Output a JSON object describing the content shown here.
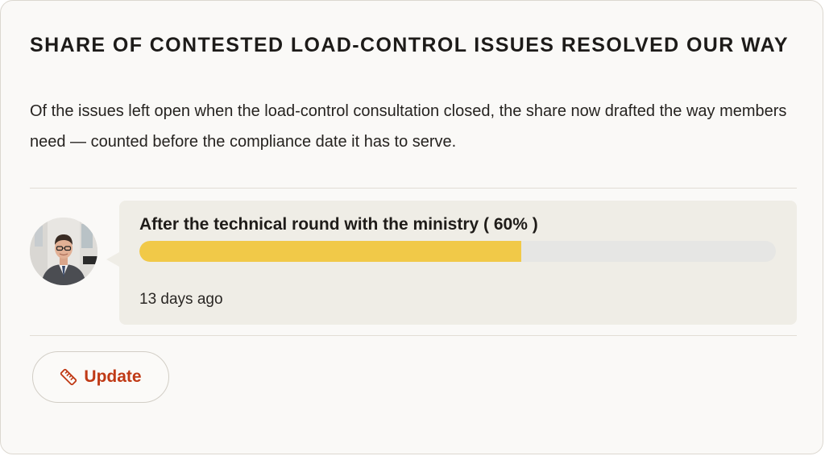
{
  "card": {
    "title": "SHARE OF CONTESTED LOAD-CONTROL ISSUES RESOLVED OUR WAY",
    "description": "Of the issues left open when the load-control consultation closed, the share now drafted the way members need — counted before the compliance date it has to serve."
  },
  "update_entry": {
    "label": "After the technical round with the ministry ( 60% )",
    "progress_percent": 60,
    "timestamp": "13 days ago",
    "avatar_icon": "person-photo",
    "bar_color": "#f1c948",
    "track_color": "#e6e6e4"
  },
  "actions": {
    "update_label": "Update",
    "update_icon": "ruler-icon",
    "accent_color": "#c03a16"
  }
}
